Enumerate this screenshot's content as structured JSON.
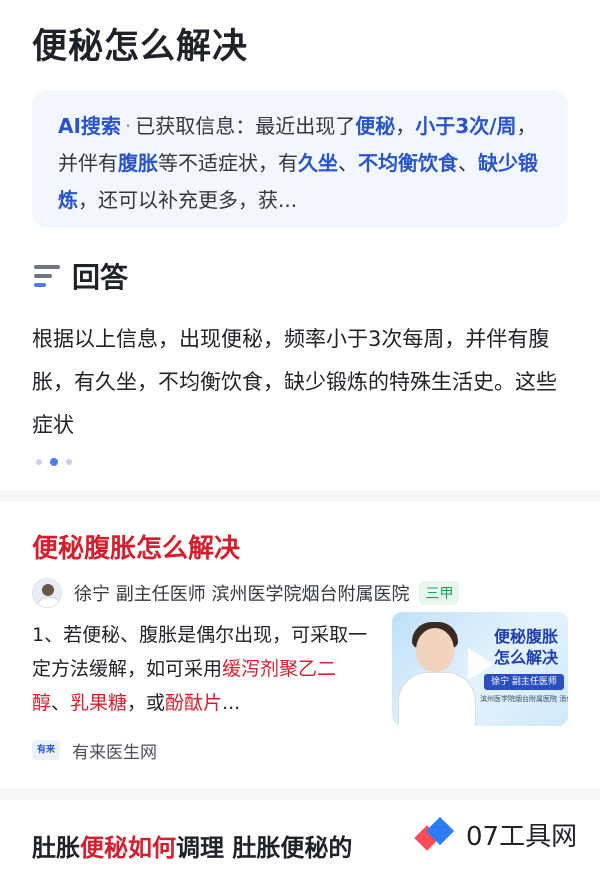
{
  "page_title": "便秘怎么解决",
  "ai_summary": {
    "label": "AI搜索",
    "sep": "·",
    "parts": [
      {
        "t": "已获取信息：最近出现了",
        "b": false
      },
      {
        "t": "便秘",
        "b": true
      },
      {
        "t": "，",
        "b": false
      },
      {
        "t": "小于3次/周",
        "b": true
      },
      {
        "t": "，并伴有",
        "b": false
      },
      {
        "t": "腹胀",
        "b": true
      },
      {
        "t": "等不适症状，有",
        "b": false
      },
      {
        "t": "久坐",
        "b": true
      },
      {
        "t": "、",
        "b": false
      },
      {
        "t": "不均衡饮食",
        "b": true
      },
      {
        "t": "、",
        "b": false
      },
      {
        "t": "缺少锻炼",
        "b": true
      },
      {
        "t": "，还可以补充更多，获...",
        "b": false
      }
    ]
  },
  "answer": {
    "heading": "回答",
    "text": "根据以上信息，出现便秘，频率小于3次每周，并伴有腹胀，有久坐，不均衡饮食，缺少锻炼的特殊生活史。这些症状",
    "carousel": {
      "count": 3,
      "active": 1
    }
  },
  "result": {
    "title": "便秘腹胀怎么解决",
    "doctor": "徐宁 副主任医师 滨州医学院烟台附属医院",
    "badge": "三甲",
    "body_parts": [
      {
        "t": "1、若便秘、腹胀是偶尔出现，可采取一定方法缓解，如可采用",
        "hl": false
      },
      {
        "t": "缓泻剂聚乙二醇",
        "hl": true
      },
      {
        "t": "、",
        "hl": false
      },
      {
        "t": "乳果糖",
        "hl": true
      },
      {
        "t": "，或",
        "hl": false
      },
      {
        "t": "酚酞片",
        "hl": true
      },
      {
        "t": "...",
        "hl": false
      }
    ],
    "video": {
      "title": "便秘腹胀怎么解决",
      "doctor_tag": "徐宁 副主任医师",
      "hospital": "滨州医学院烟台附属医院 消化"
    },
    "source_logo": "有来",
    "source": "有来医生网"
  },
  "next_result": {
    "parts": [
      {
        "t": "肚胀",
        "hl": false
      },
      {
        "t": "便秘如何",
        "hl": true
      },
      {
        "t": "调理 肚胀便秘的",
        "hl": false
      }
    ]
  },
  "watermark": {
    "text": "07工具网"
  }
}
